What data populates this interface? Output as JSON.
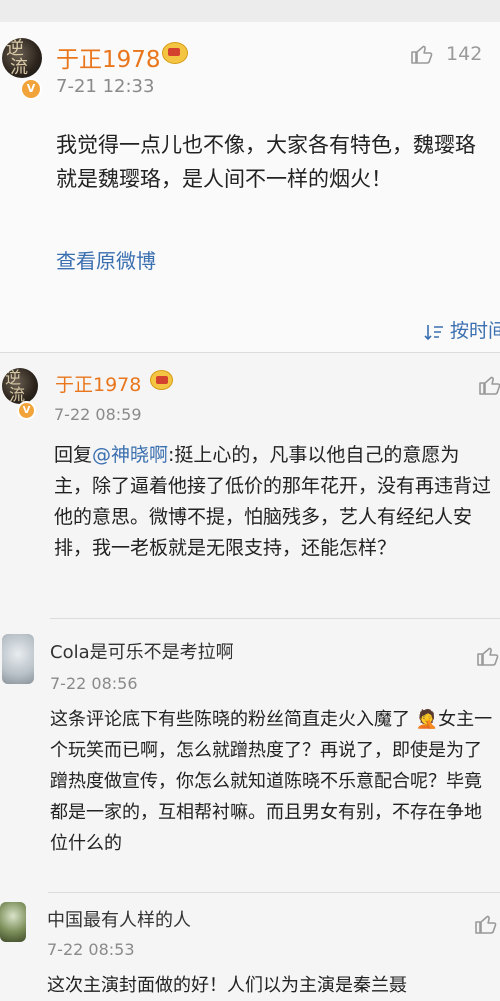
{
  "comments": [
    {
      "username": "于正1978",
      "time": "7-21 12:33",
      "like_count": "142",
      "text": "我觉得一点儿也不像，大家各有特色，魏璎珞就是魏璎珞，是人间不一样的烟火！",
      "link": "查看原微博"
    },
    {
      "username": "于正1978",
      "time": "7-22 08:59",
      "reply_prefix": "回复",
      "mention": "@神晓啊",
      "text": ":挺上心的，凡事以他自己的意愿为主，除了逼着他接了低价的那年花开，没有再违背过他的意思。微博不提，怕脑残多，艺人有经纪人安排，我一老板就是无限支持，还能怎样？"
    },
    {
      "username": "Cola是可乐不是考拉啊",
      "time": "7-22 08:56",
      "text": "这条评论底下有些陈晓的粉丝简直走火入魔了 🤦女主一个玩笑而已啊，怎么就蹭热度了？再说了，即使是为了蹭热度做宣传，你怎么就知道陈晓不乐意配合呢？毕竟都是一家的，互相帮衬嘛。而且男女有别，不存在争地位什么的"
    },
    {
      "username": "中国最有人样的人",
      "time": "7-22 08:53",
      "text": "这次主演封面做的好！人们以为主演是秦兰聂"
    }
  ],
  "sort": {
    "label": "按时间"
  },
  "icons": {
    "like": "thumbs-up-icon",
    "sort": "sort-lines-icon",
    "vip": "crown-icon",
    "verified": "v-badge-icon"
  },
  "colors": {
    "username_vip": "#e9761c",
    "link": "#3a6fb0",
    "time": "#8a8a8a"
  }
}
